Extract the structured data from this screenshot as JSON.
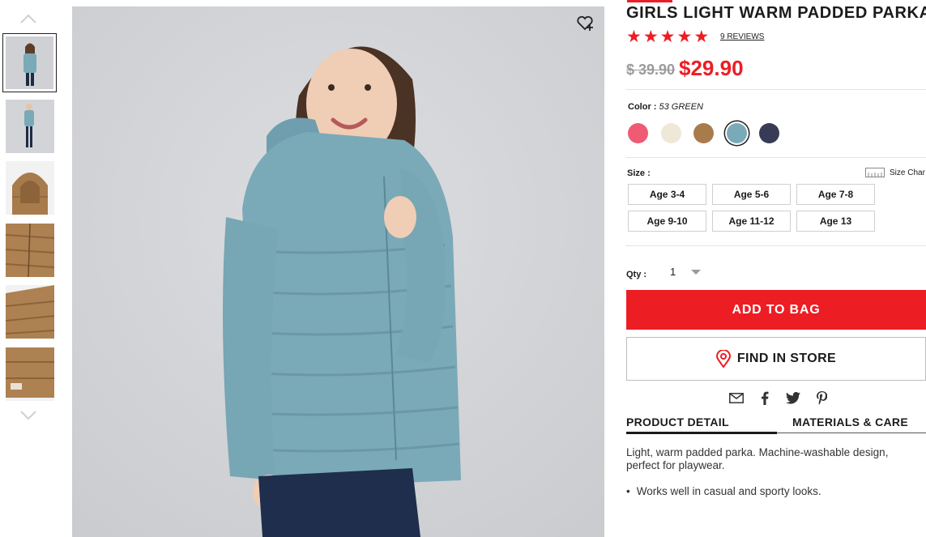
{
  "product": {
    "title": "GIRLS LIGHT WARM PADDED PARKA",
    "rating": 5,
    "reviews": "9 REVIEWS",
    "old_price": "$ 39.90",
    "new_price": "$29.90"
  },
  "color": {
    "label": "Color :",
    "value": "53 GREEN",
    "swatches": [
      "#ee5b73",
      "#efe8d9",
      "#a87b4d",
      "#7aaab8",
      "#373b56"
    ],
    "selected_index": 3
  },
  "size": {
    "label": "Size :",
    "chart_label": "Size Char",
    "options": [
      "Age 3-4",
      "Age 5-6",
      "Age 7-8",
      "Age 9-10",
      "Age 11-12",
      "Age 13"
    ]
  },
  "qty": {
    "label": "Qty :",
    "value": "1"
  },
  "buttons": {
    "add_to_bag": "ADD TO BAG",
    "find_in_store": "FIND IN STORE"
  },
  "share_icons": [
    "mail-icon",
    "facebook-icon",
    "twitter-icon",
    "pinterest-icon"
  ],
  "tabs": {
    "detail": "PRODUCT DETAIL",
    "materials": "MATERIALS & CARE"
  },
  "description": {
    "text": "Light, warm padded parka. Machine-washable design, perfect for playwear.",
    "bullet": "Works well in casual and sporty looks."
  },
  "colors": {
    "accent": "#ed1d24",
    "jacket": "#7aaab8",
    "brown": "#a87b4d"
  }
}
